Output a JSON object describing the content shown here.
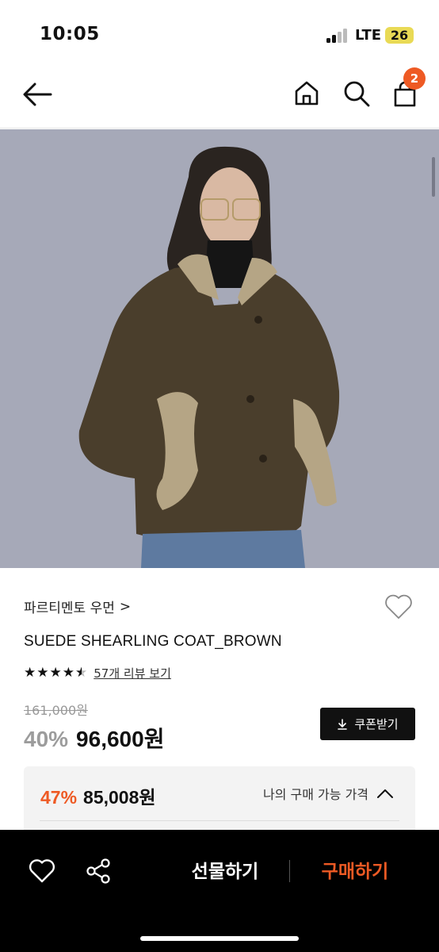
{
  "status": {
    "time": "10:05",
    "network": "LTE",
    "battery": "26"
  },
  "nav": {
    "cart_count": "2"
  },
  "product": {
    "brand": "파르티멘토 우먼",
    "brand_chevron": ">",
    "name": "SUEDE SHEARLING COAT_BROWN",
    "rating": 4.5,
    "review_link": "57개 리뷰 보기",
    "original_price": "161,000원",
    "discount": "40%",
    "price": "96,600원"
  },
  "coupon": {
    "label": "쿠폰받기"
  },
  "buy_price": {
    "discount": "47%",
    "price": "85,008원",
    "label": "나의 구매 가능 가격"
  },
  "bottom": {
    "gift_label": "선물하기",
    "buy_label": "구매하기"
  },
  "colors": {
    "accent": "#ee5a24",
    "battery": "#e9da55",
    "hero_bg": "#a6a9b8",
    "coat": "#4a3e2c"
  }
}
